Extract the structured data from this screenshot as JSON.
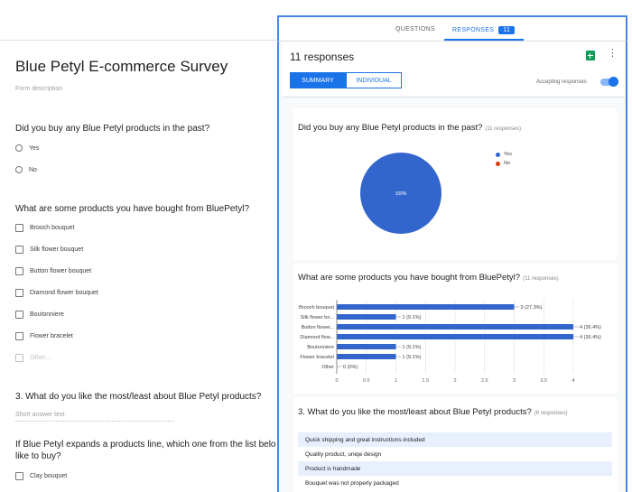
{
  "form": {
    "title": "Blue Petyl E-commerce Survey",
    "description_placeholder": "Form description",
    "q1": {
      "text": "Did you buy any Blue Petyl products in the past?",
      "options": [
        "Yes",
        "No"
      ]
    },
    "q2": {
      "text": "What are some products you have bought from BluePetyl?",
      "options": [
        "Brooch bouquet",
        "Silk flower bouquet",
        "Button flower bouquet",
        "Diamond flower bouquet",
        "Boutonniere",
        "Flower bracelet",
        "Other..."
      ]
    },
    "q3": {
      "text": "3.    What do you like the most/least about Blue Petyl products?",
      "placeholder": "Short answer text"
    },
    "q4": {
      "text_line1": "If Blue Petyl expands a products line, which one from the list belo",
      "text_line2": "like to buy?",
      "options": [
        "Clay bouquet"
      ]
    }
  },
  "tabs": {
    "questions": "QUESTIONS",
    "responses": "RESPONSES",
    "responses_badge": "11"
  },
  "responses": {
    "count_label": "11 responses",
    "summary_label": "SUMMARY",
    "individual_label": "INDIVIDUAL",
    "accepting_label": "Accepting responses"
  },
  "summary": {
    "q1": {
      "title": "Did you buy any Blue Petyl products in the past?",
      "count": "(11 responses)",
      "pie_label": "100%"
    },
    "q2": {
      "title": "What are some products you have bought from BluePetyl?",
      "count": "(11 responses)"
    },
    "q3": {
      "title": "3. What do you like the most/least about Blue Petyl products?",
      "count": "(6 responses)",
      "answers": [
        "Quick shipping and great instructions included",
        "Quality product, uniqe design",
        "Product is handmade",
        "Bouquet was not properly packaged"
      ]
    }
  },
  "colors": {
    "accent": "#1a73e8",
    "yes": "#3366cc",
    "no": "#dc3912",
    "bar": "#3366cc"
  },
  "chart_data": [
    {
      "type": "pie",
      "labels": [
        "Yes",
        "No"
      ],
      "values": [
        11,
        0
      ],
      "slice_label": "100%",
      "legend": "right"
    },
    {
      "type": "bar",
      "orientation": "horizontal",
      "categories": [
        "Brooch bouquet",
        "Silk flower bo...",
        "Button flower...",
        "Diamond flow...",
        "Boutonniere",
        "Flower bracelet",
        "Other"
      ],
      "values": [
        3,
        1,
        4,
        4,
        1,
        1,
        0
      ],
      "value_labels": [
        "3 (27.3%)",
        "1 (9.1%)",
        "4 (36.4%)",
        "4 (36.4%)",
        "1 (9.1%)",
        "1 (9.1%)",
        "0 (0%)"
      ],
      "xticks": [
        "0",
        "0.5",
        "1",
        "1.5",
        "2",
        "2.5",
        "3",
        "3.5",
        "4"
      ],
      "xlim": [
        0,
        4
      ]
    }
  ]
}
